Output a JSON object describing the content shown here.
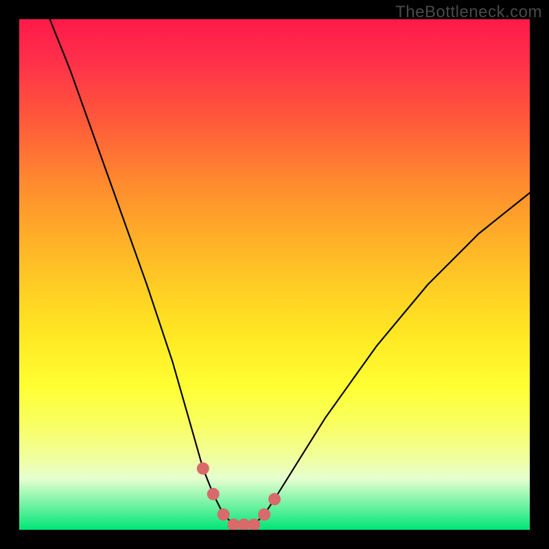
{
  "watermark": "TheBottleneck.com",
  "chart_data": {
    "type": "line",
    "title": "",
    "xlabel": "",
    "ylabel": "",
    "xlim": [
      0,
      100
    ],
    "ylim": [
      0,
      100
    ],
    "series": [
      {
        "name": "bottleneck-curve",
        "x": [
          6,
          10,
          15,
          20,
          25,
          30,
          34,
          36,
          38,
          40,
          42,
          44,
          46,
          48,
          50,
          55,
          60,
          65,
          70,
          75,
          80,
          85,
          90,
          95,
          100
        ],
        "values": [
          100,
          90,
          76,
          62,
          48,
          33,
          19,
          12,
          7,
          3,
          1,
          1,
          1,
          3,
          6,
          14,
          22,
          29,
          36,
          42,
          48,
          53,
          58,
          62,
          66
        ]
      }
    ],
    "markers": {
      "name": "highlight-dots",
      "color": "#d86a6a",
      "x": [
        36,
        38,
        40,
        42,
        44,
        46,
        48,
        50
      ],
      "values": [
        12,
        7,
        3,
        1,
        1,
        1,
        3,
        6
      ]
    },
    "background": "rainbow-vertical-gradient"
  }
}
